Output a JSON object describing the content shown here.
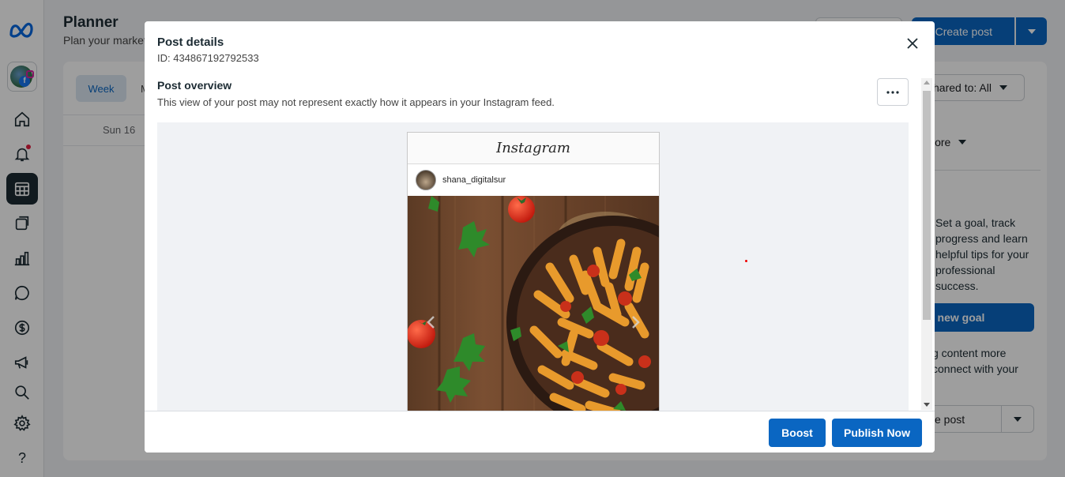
{
  "app": {
    "title": "Planner",
    "subtitle": "Plan your market"
  },
  "header": {
    "create_post_label": "Create post"
  },
  "calendar": {
    "view_tabs": [
      "Week",
      "M"
    ],
    "day_label": "Sun 16"
  },
  "right_panel": {
    "shared_filter": "hared to: All",
    "more_label": "lore",
    "goal_text": "Set a goal, track progress and learn helpful tips for your professional success.",
    "goal_button": "t new goal",
    "content_text": "g content more connect with your",
    "post_select": "e post"
  },
  "modal": {
    "title": "Post details",
    "id_text": "ID: 434867192792533",
    "overview_title": "Post overview",
    "overview_desc": "This view of your post may not represent exactly how it appears in your Instagram feed.",
    "preview": {
      "platform_logo": "Instagram",
      "username": "shana_digitalsur"
    },
    "footer": {
      "boost_label": "Boost",
      "publish_label": "Publish Now"
    }
  },
  "colors": {
    "primary": "#0a66c2",
    "sidebar_active": "#1c2b33",
    "overlay": "rgba(0,0,0,0.38)"
  }
}
